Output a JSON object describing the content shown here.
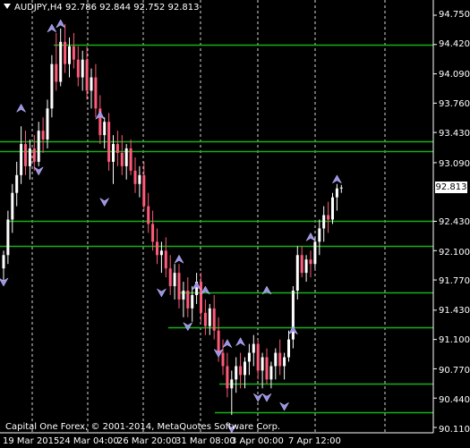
{
  "window": {
    "title": "AUDJPY,H4  92.786 92.844 92.752 92.813",
    "copyright": "Capital One Forex, © 2001-2014, MetaQuotes Software Corp.",
    "price_tag": "92.813"
  },
  "colors": {
    "background": "#000000",
    "bull_candle": "#ffffff",
    "bear_candle": "#ff5a78",
    "level_lines": "#17b117",
    "fractal_arrows": "#9a92e6",
    "grid": "#ffffff"
  },
  "y_axis": [
    "94.750",
    "94.420",
    "94.090",
    "93.760",
    "93.430",
    "93.090",
    "92.430",
    "92.100",
    "91.770",
    "91.430",
    "91.100",
    "90.770",
    "90.440",
    "90.110"
  ],
  "x_axis": [
    "19 Mar 2015",
    "24 Mar 04:00",
    "26 Mar 20:00",
    "31 Mar 08:00",
    "3 Apr 00:00",
    "7 Apr 12:00"
  ],
  "chart_data": {
    "type": "candlestick",
    "symbol": "AUDJPY",
    "timeframe": "H4",
    "ohlc_last": {
      "open": 92.786,
      "high": 92.844,
      "low": 92.752,
      "close": 92.813
    },
    "ylim": [
      90.11,
      94.75
    ],
    "levels": [
      94.42,
      93.33,
      93.22,
      92.43,
      92.15,
      91.63,
      91.24,
      90.6,
      90.28
    ],
    "candles": [
      [
        91.9,
        92.1,
        91.75,
        92.05
      ],
      [
        92.05,
        92.55,
        91.95,
        92.45
      ],
      [
        92.45,
        92.85,
        92.3,
        92.75
      ],
      [
        92.75,
        93.1,
        92.6,
        92.95
      ],
      [
        92.95,
        93.5,
        92.85,
        93.3
      ],
      [
        93.3,
        93.45,
        92.95,
        93.05
      ],
      [
        93.05,
        93.35,
        92.9,
        93.25
      ],
      [
        93.25,
        93.4,
        93.0,
        93.1
      ],
      [
        93.1,
        93.55,
        93.05,
        93.45
      ],
      [
        93.45,
        93.6,
        93.2,
        93.35
      ],
      [
        93.35,
        93.8,
        93.25,
        93.7
      ],
      [
        93.7,
        94.3,
        93.6,
        94.2
      ],
      [
        94.2,
        94.55,
        93.9,
        94.0
      ],
      [
        94.0,
        94.6,
        93.95,
        94.45
      ],
      [
        94.45,
        94.65,
        94.1,
        94.2
      ],
      [
        94.2,
        94.5,
        94.05,
        94.4
      ],
      [
        94.4,
        94.55,
        94.15,
        94.25
      ],
      [
        94.25,
        94.4,
        93.95,
        94.05
      ],
      [
        94.05,
        94.35,
        93.9,
        94.25
      ],
      [
        94.25,
        94.4,
        93.8,
        93.9
      ],
      [
        93.9,
        94.15,
        93.7,
        94.05
      ],
      [
        94.05,
        94.2,
        93.6,
        93.7
      ],
      [
        93.7,
        93.85,
        93.3,
        93.4
      ],
      [
        93.4,
        93.6,
        93.25,
        93.55
      ],
      [
        93.55,
        93.65,
        93.0,
        93.1
      ],
      [
        93.1,
        93.4,
        92.85,
        93.3
      ],
      [
        93.3,
        93.45,
        93.05,
        93.2
      ],
      [
        93.2,
        93.4,
        92.95,
        93.05
      ],
      [
        93.05,
        93.3,
        92.9,
        93.25
      ],
      [
        93.25,
        93.35,
        92.95,
        93.0
      ],
      [
        93.0,
        93.15,
        92.75,
        92.85
      ],
      [
        92.85,
        93.05,
        92.7,
        92.95
      ],
      [
        92.95,
        93.1,
        92.55,
        92.6
      ],
      [
        92.6,
        92.75,
        92.3,
        92.4
      ],
      [
        92.4,
        92.55,
        92.1,
        92.2
      ],
      [
        92.2,
        92.35,
        91.95,
        92.05
      ],
      [
        92.05,
        92.2,
        91.85,
        92.1
      ],
      [
        92.1,
        92.25,
        91.8,
        91.9
      ],
      [
        91.9,
        92.05,
        91.6,
        91.7
      ],
      [
        91.7,
        91.95,
        91.55,
        91.85
      ],
      [
        91.85,
        91.95,
        91.45,
        91.55
      ],
      [
        91.55,
        91.75,
        91.35,
        91.65
      ],
      [
        91.65,
        91.8,
        91.35,
        91.45
      ],
      [
        91.45,
        91.7,
        91.3,
        91.6
      ],
      [
        91.6,
        91.85,
        91.5,
        91.75
      ],
      [
        91.75,
        91.85,
        91.3,
        91.4
      ],
      [
        91.4,
        91.55,
        91.15,
        91.25
      ],
      [
        91.25,
        91.5,
        91.15,
        91.45
      ],
      [
        91.45,
        91.6,
        91.1,
        91.2
      ],
      [
        91.2,
        91.35,
        90.85,
        90.95
      ],
      [
        90.95,
        91.1,
        90.7,
        90.8
      ],
      [
        90.8,
        90.95,
        90.45,
        90.55
      ],
      [
        90.55,
        90.75,
        90.25,
        90.65
      ],
      [
        90.65,
        90.9,
        90.5,
        90.8
      ],
      [
        90.8,
        90.95,
        90.55,
        90.7
      ],
      [
        90.7,
        90.9,
        90.55,
        90.85
      ],
      [
        90.85,
        91.05,
        90.7,
        90.95
      ],
      [
        90.95,
        91.15,
        90.8,
        91.05
      ],
      [
        91.05,
        91.1,
        90.65,
        90.75
      ],
      [
        90.75,
        90.95,
        90.55,
        90.9
      ],
      [
        90.9,
        91.0,
        90.6,
        90.65
      ],
      [
        90.65,
        90.85,
        90.55,
        90.8
      ],
      [
        90.8,
        91.0,
        90.65,
        90.95
      ],
      [
        90.95,
        91.1,
        90.7,
        90.8
      ],
      [
        90.8,
        90.95,
        90.65,
        90.9
      ],
      [
        90.9,
        91.2,
        90.85,
        91.1
      ],
      [
        91.1,
        91.7,
        91.0,
        91.65
      ],
      [
        91.65,
        92.15,
        91.55,
        92.05
      ],
      [
        92.05,
        92.15,
        91.8,
        91.85
      ],
      [
        91.85,
        92.05,
        91.75,
        92.0
      ],
      [
        92.0,
        92.1,
        91.8,
        91.95
      ],
      [
        91.95,
        92.25,
        91.9,
        92.2
      ],
      [
        92.2,
        92.45,
        92.05,
        92.35
      ],
      [
        92.35,
        92.6,
        92.2,
        92.5
      ],
      [
        92.5,
        92.65,
        92.3,
        92.45
      ],
      [
        92.45,
        92.75,
        92.4,
        92.7
      ],
      [
        92.7,
        92.85,
        92.55,
        92.8
      ],
      [
        92.8,
        92.84,
        92.75,
        92.81
      ]
    ],
    "fractals_up": [
      [
        4,
        93.75
      ],
      [
        11,
        94.65
      ],
      [
        13,
        94.7
      ],
      [
        22,
        93.67
      ],
      [
        40,
        92.05
      ],
      [
        44,
        91.75
      ],
      [
        46,
        91.7
      ],
      [
        51,
        91.1
      ],
      [
        54,
        91.12
      ],
      [
        60,
        91.7
      ],
      [
        66,
        91.25
      ],
      [
        70,
        92.3
      ],
      [
        76,
        92.95
      ]
    ],
    "fractals_down": [
      [
        0,
        91.7
      ],
      [
        8,
        92.95
      ],
      [
        23,
        92.6
      ],
      [
        36,
        91.58
      ],
      [
        42,
        91.2
      ],
      [
        49,
        90.9
      ],
      [
        52,
        90.05
      ],
      [
        58,
        90.4
      ],
      [
        60,
        90.4
      ],
      [
        64,
        90.3
      ]
    ]
  }
}
